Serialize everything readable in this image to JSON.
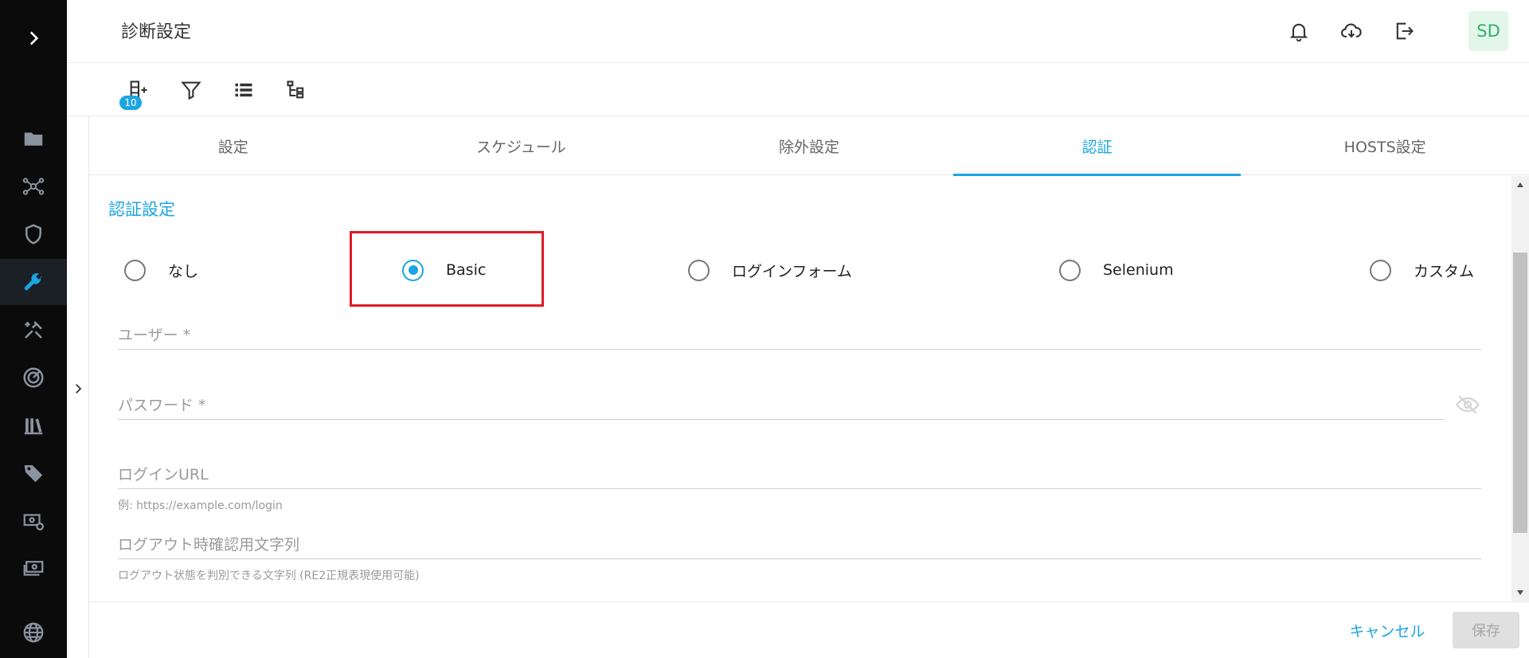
{
  "sidebar": {
    "expand_icon": "chevron-right-icon",
    "items": [
      {
        "icon": "folder-icon",
        "active": false
      },
      {
        "icon": "network-icon",
        "active": false
      },
      {
        "icon": "shield-icon",
        "active": false
      },
      {
        "icon": "wrench-icon",
        "active": true
      },
      {
        "icon": "tools-icon",
        "active": false
      },
      {
        "icon": "radar-icon",
        "active": false
      },
      {
        "icon": "library-icon",
        "active": false
      },
      {
        "icon": "tag-icon",
        "active": false
      },
      {
        "icon": "money-settings-icon",
        "active": false
      },
      {
        "icon": "payments-icon",
        "active": false
      },
      {
        "icon": "globe-icon",
        "active": false
      }
    ]
  },
  "header": {
    "title": "診断設定",
    "avatar": "SD"
  },
  "toolbar": {
    "badge_count": "10"
  },
  "tabs": [
    {
      "label": "設定",
      "active": false
    },
    {
      "label": "スケジュール",
      "active": false
    },
    {
      "label": "除外設定",
      "active": false
    },
    {
      "label": "認証",
      "active": true
    },
    {
      "label": "HOSTS設定",
      "active": false
    }
  ],
  "auth": {
    "section_title": "認証設定",
    "options": [
      "なし",
      "Basic",
      "ログインフォーム",
      "Selenium",
      "カスタム"
    ],
    "selected": "Basic",
    "fields": {
      "user_placeholder": "ユーザー *",
      "password_placeholder": "パスワード *",
      "login_url_placeholder": "ログインURL",
      "login_url_hint": "例: https://example.com/login",
      "logout_text_placeholder": "ログアウト時確認用文字列",
      "logout_text_hint": "ログアウト状態を判別できる文字列 (RE2正規表現使用可能)"
    }
  },
  "footer": {
    "cancel_label": "キャンセル",
    "save_label": "保存"
  },
  "colors": {
    "accent": "#1ba5e0",
    "highlight": "#e01b24",
    "sidebar_bg": "#0b0b0b",
    "avatar_bg": "#e3f6ea",
    "avatar_text": "#2fb26a"
  }
}
